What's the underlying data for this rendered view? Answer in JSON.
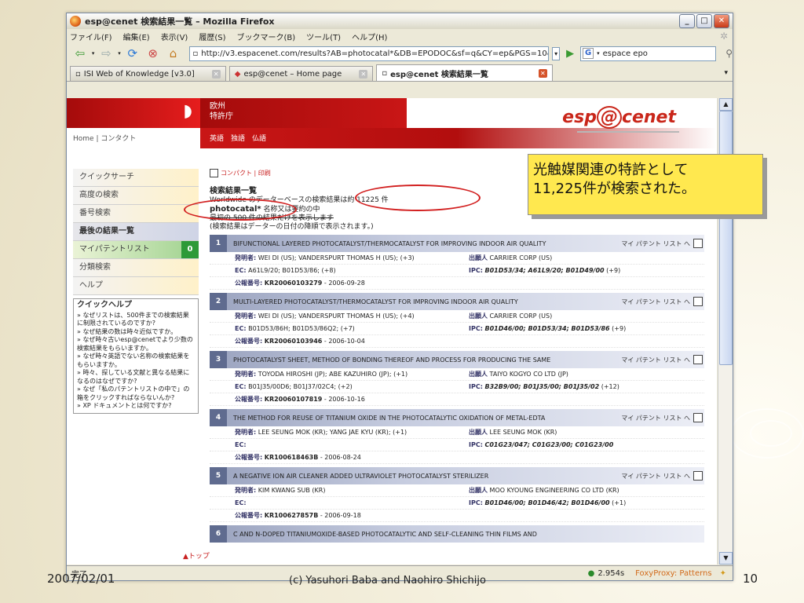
{
  "window": {
    "title": "esp@cenet 検索結果一覧 – Mozilla Firefox"
  },
  "menu": [
    "ファイル(F)",
    "編集(E)",
    "表示(V)",
    "履歴(S)",
    "ブックマーク(B)",
    "ツール(T)",
    "ヘルプ(H)"
  ],
  "url": "http://v3.espacenet.com/results?AB=photocatal*&DB=EPODOC&sf=q&CY=ep&PGS=10&S",
  "search": {
    "engine": "G",
    "value": "espace epo"
  },
  "tabs": [
    {
      "label": "ISI Web of Knowledge [v3.0]"
    },
    {
      "label": "esp@cenet – Home page"
    },
    {
      "label": "esp@cenet 検索結果一覧"
    }
  ],
  "site": {
    "epo_line1": "欧州",
    "epo_line2": "特許庁",
    "home_link": "Home | コンタクト",
    "lang_links": "英語　独語　仏語",
    "logo": "espacenet"
  },
  "leftnav": {
    "items": [
      "クイックサーチ",
      "高度の検索",
      "番号検索",
      "最後の結果一覧",
      "マイパテントリスト",
      "分類検索",
      "ヘルプ"
    ],
    "mylist_count": "0",
    "quickhelp_title": "クイックヘルプ",
    "quickhelp": [
      "» なぜリストは、500件までの検索結果に制限されているのですか?",
      "» なぜ結果の数は時々近似ですか。",
      "» なぜ時々古いesp@cenetでより少数の検索結果をもらいますか。",
      "» なぜ時々英語でない名称の検索結果をもらいますか。",
      "» 時々、探している文献と異なる結果になるのはなぜですか?",
      "» なぜ「私のパテントリストの中で」の箱をクリックすればならないんか?",
      "» XP ドキュメントとは何ですか?"
    ],
    "top_link": "▲トップ"
  },
  "main": {
    "compact": "コンパクト | 印刷",
    "heading": "検索結果一覧",
    "line1": "Worldwide のデーターベースの検索結果は約 11225 件",
    "query": "photocatal*",
    "line2": " 名称又は要約の中",
    "line3": "最初の 500 件の結果だけを表示します",
    "line4": "(検索結果はデーターの日付の降順で表示されます。)"
  },
  "labels": {
    "inventor": "発明者:",
    "applicant": "出願人",
    "ec": "EC:",
    "ipc": "IPC:",
    "pub": "公報番号:",
    "mylist": "マイ パテント リスト へ"
  },
  "results": [
    {
      "num": "1",
      "title": "BIFUNCTIONAL LAYERED PHOTOCATALYST/THERMOCATALYST FOR IMPROVING INDOOR AIR QUALITY",
      "inventor": "WEI DI (US); VANDERSPURT THOMAS H (US); (+3)",
      "applicant": "CARRIER CORP (US)",
      "ec": "A61L9/20; B01D53/86; (+8)",
      "ipc": "B01D53/34; A61L9/20; B01D49/00",
      "ipc_more": " (+9)",
      "pub": "KR20060103279",
      "date": " - 2006-09-28"
    },
    {
      "num": "2",
      "title": "MULTI-LAYERED PHOTOCATALYST/THERMOCATALYST FOR IMPROVING INDOOR AIR QUALITY",
      "inventor": "WEI DI (US); VANDERSPURT THOMAS H (US); (+4)",
      "applicant": "CARRIER CORP (US)",
      "ec": "B01D53/86H; B01D53/86Q2; (+7)",
      "ipc": "B01D46/00; B01D53/34; B01D53/86",
      "ipc_more": " (+9)",
      "pub": "KR20060103946",
      "date": " - 2006-10-04"
    },
    {
      "num": "3",
      "title": "PHOTOCATALYST SHEET, METHOD OF BONDING THEREOF AND PROCESS FOR PRODUCING THE SAME",
      "inventor": "TOYODA HIROSHI (JP); ABE KAZUHIRO (JP); (+1)",
      "applicant": "TAIYO KOGYO CO LTD (JP)",
      "ec": "B01J35/00D6; B01J37/02C4; (+2)",
      "ipc": "B32B9/00; B01J35/00; B01J35/02",
      "ipc_more": " (+12)",
      "pub": "KR20060107819",
      "date": " - 2006-10-16"
    },
    {
      "num": "4",
      "title": "THE METHOD FOR REUSE OF TITANIUM OXIDE IN THE PHOTOCATALYTIC OXIDATION OF METAL-EDTA",
      "inventor": "LEE SEUNG MOK (KR); YANG JAE KYU (KR); (+1)",
      "applicant": "LEE SEUNG MOK (KR)",
      "ec": "",
      "ipc": "C01G23/047; C01G23/00; C01G23/00",
      "ipc_more": "",
      "pub": "KR100618463B",
      "date": " - 2006-08-24"
    },
    {
      "num": "5",
      "title": "A NEGATIVE ION AIR CLEANER ADDED ULTRAVIOLET PHOTOCATALYST STERILIZER",
      "inventor": "KIM KWANG SUB (KR)",
      "applicant": "MOO KYOUNG ENGINEERING CO LTD (KR)",
      "ec": "",
      "ipc": "B01D46/00; B01D46/42; B01D46/00",
      "ipc_more": " (+1)",
      "pub": "KR100627857B",
      "date": " - 2006-09-18"
    },
    {
      "num": "6",
      "title": "C AND N-DOPED TITANIUMOXIDE-BASED PHOTOCATALYTIC AND SELF-CLEANING THIN FILMS AND"
    }
  ],
  "status": {
    "text": "完了",
    "time": "2.954s",
    "proxy": "FoxyProxy: Patterns"
  },
  "callout": {
    "line1": "光触媒関連の特許として",
    "line2": "11,225件が検索された。"
  },
  "slide": {
    "date": "2007/02/01",
    "credit": "(c) Yasuhori Baba and Naohiro Shichijo",
    "page": "10"
  }
}
